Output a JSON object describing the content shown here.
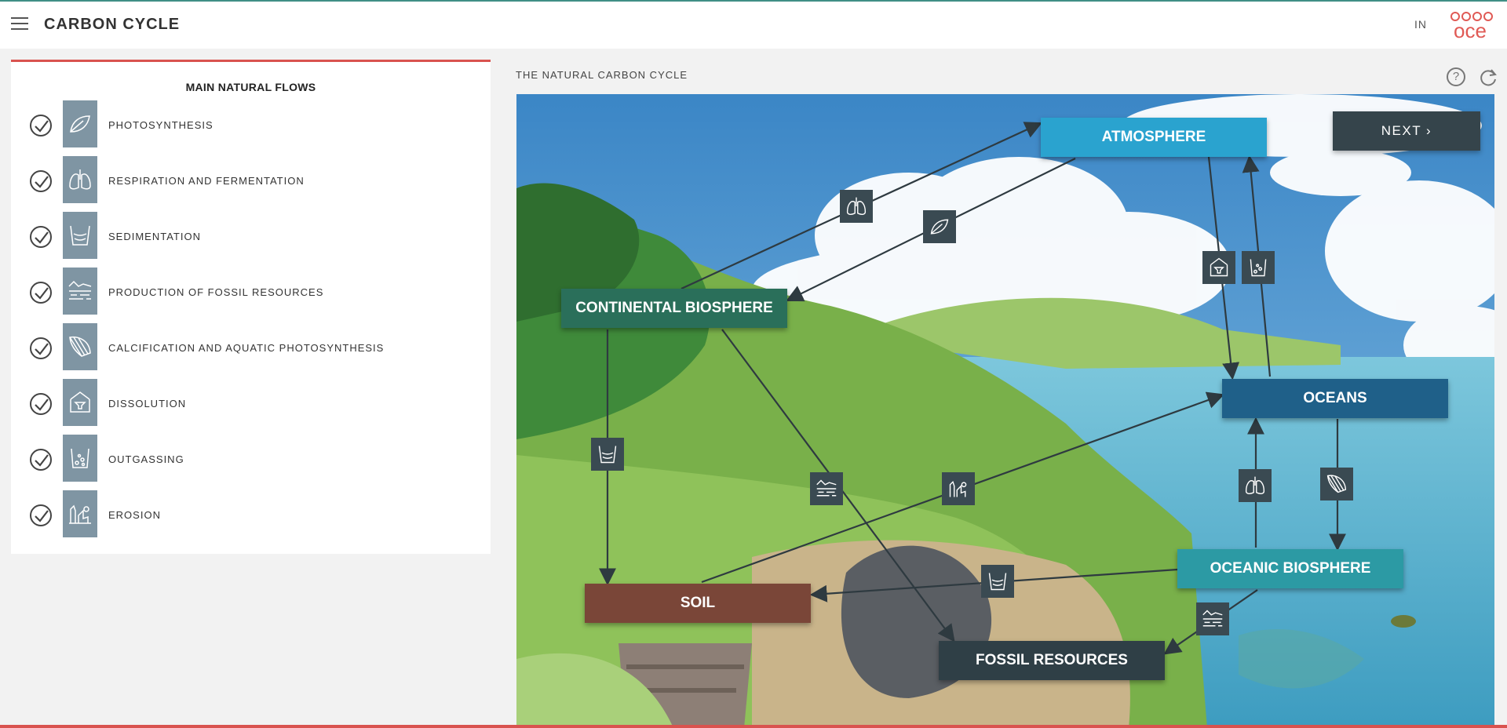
{
  "header": {
    "app_title": "CARBON CYCLE",
    "lang": "IN",
    "logo_text": "oce",
    "menu_icon": "hamburger-menu-icon"
  },
  "sidebar": {
    "title": "MAIN NATURAL FLOWS",
    "items": [
      {
        "label": "PHOTOSYNTHESIS",
        "icon": "leaf-icon",
        "checked": true
      },
      {
        "label": "RESPIRATION AND FERMENTATION",
        "icon": "lungs-icon",
        "checked": true
      },
      {
        "label": "SEDIMENTATION",
        "icon": "sediment-beaker-icon",
        "checked": true
      },
      {
        "label": "PRODUCTION OF FOSSIL RESOURCES",
        "icon": "fossil-layers-icon",
        "checked": true
      },
      {
        "label": "CALCIFICATION AND AQUATIC PHOTOSYNTHESIS",
        "icon": "shell-icon",
        "checked": true
      },
      {
        "label": "DISSOLUTION",
        "icon": "dissolution-icon",
        "checked": true
      },
      {
        "label": "OUTGASSING",
        "icon": "bubbles-icon",
        "checked": true
      },
      {
        "label": "EROSION",
        "icon": "erosion-icon",
        "checked": true
      }
    ]
  },
  "diagram": {
    "title": "THE NATURAL CARBON CYCLE",
    "help_icon": "help-icon",
    "reset_icon": "refresh-icon",
    "next_label": "NEXT",
    "nodes": {
      "atmosphere": "ATMOSPHERE",
      "continental": "CONTINENTAL BIOSPHERE",
      "oceans": "OCEANS",
      "oceanic": "OCEANIC BIOSPHERE",
      "soil": "SOIL",
      "fossil": "FOSSIL RESOURCES"
    }
  },
  "colors": {
    "accent_red": "#d9534f",
    "atmosphere": "#2aa3cf",
    "continental": "#2a6f5a",
    "oceans": "#1f6089",
    "oceanic": "#2c9aa4",
    "soil": "#7a4638",
    "fossil": "#2f3f46",
    "tile": "#7f95a3",
    "badge": "#3a4a52"
  }
}
